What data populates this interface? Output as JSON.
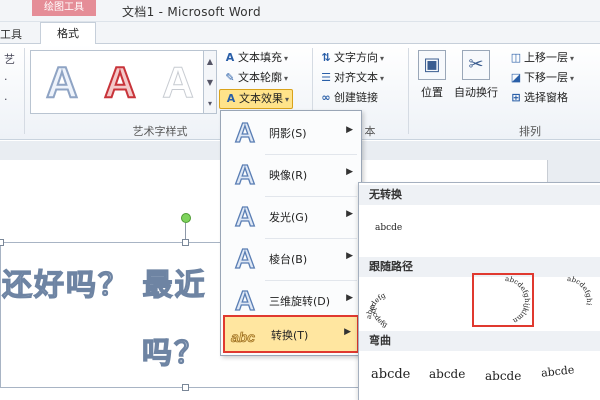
{
  "titlebar": {
    "context_group": "绘图工具",
    "window_title": "文档1 - Microsoft Word"
  },
  "tabs": {
    "left_partial": "工具",
    "format": "格式"
  },
  "ribbon": {
    "left_stub": [
      "艺",
      "·",
      "·"
    ],
    "wordart_group_label": "艺术字样式",
    "wordart_samples": [
      "A",
      "A",
      "A"
    ],
    "text_fill": "文本填充",
    "text_outline": "文本轮廓",
    "text_effects": "文本效果",
    "text_direction": "文字方向",
    "align_text": "对齐文本",
    "create_link": "创建链接",
    "text_group_partial": "本",
    "position": "位置",
    "wrap_text": "自动换行",
    "bring_forward": "上移一层",
    "send_backward": "下移一层",
    "selection_pane": "选择窗格",
    "arrange_group_label": "排列"
  },
  "document": {
    "line1": "还好吗？ 最近",
    "line2": "吗？"
  },
  "menu": {
    "items": [
      {
        "label": "阴影(S)",
        "icon": "A"
      },
      {
        "label": "映像(R)",
        "icon": "A"
      },
      {
        "label": "发光(G)",
        "icon": "A"
      },
      {
        "label": "棱台(B)",
        "icon": "A"
      },
      {
        "label": "三维旋转(D)",
        "icon": "A"
      },
      {
        "label": "转换(T)",
        "icon": "abc"
      }
    ]
  },
  "submenu": {
    "no_transform_header": "无转换",
    "no_transform_sample": "abcde",
    "follow_path_header": "跟随路径",
    "path_samples": [
      "abcdefg",
      "abcdefghijklmn",
      "abcdefghi"
    ],
    "warp_header": "弯曲",
    "warp_samples": [
      "abcde",
      "abcde",
      "abcde",
      "abcde"
    ]
  },
  "colors": {
    "highlight": "#ffe6a0",
    "red_border": "#e0392f",
    "context_tab": "#e58d97"
  }
}
